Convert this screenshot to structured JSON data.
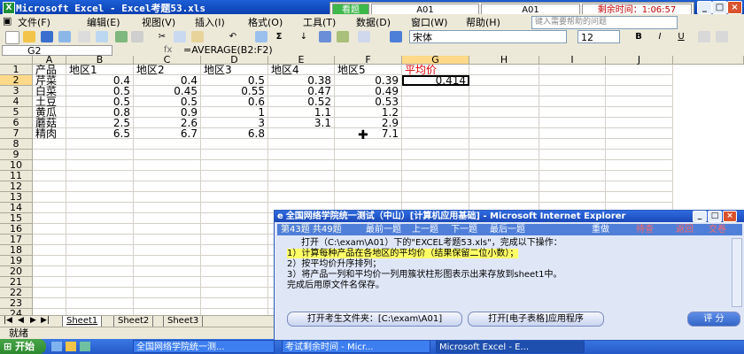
{
  "window": {
    "title": "Microsoft Excel - Excel考题53.xls",
    "controls": [
      "_",
      "□",
      "×"
    ]
  },
  "exam_bar": {
    "mode": "看题",
    "field1": "A01",
    "field2": "A01",
    "timer_label": "剩余时间：1:06:57"
  },
  "menu": {
    "items": [
      "文件(F)",
      "编辑(E)",
      "视图(V)",
      "插入(I)",
      "格式(O)",
      "工具(T)",
      "数据(D)",
      "窗口(W)",
      "帮助(H)"
    ],
    "help_placeholder": "键入需要帮助的问题"
  },
  "toolbar": {
    "font_name": "宋体",
    "font_size": "12",
    "bold": "B",
    "italic": "I",
    "underline": "U",
    "sigma": "Σ",
    "undo": "↶",
    "sort": "↓"
  },
  "formula_bar": {
    "name_box": "G2",
    "formula": "=AVERAGE(B2:F2)"
  },
  "grid": {
    "columns": [
      "A",
      "B",
      "C",
      "D",
      "E",
      "F",
      "G",
      "H",
      "I",
      "J"
    ],
    "rows": [
      "1",
      "2",
      "3",
      "4",
      "5",
      "6",
      "7",
      "8",
      "9",
      "10",
      "11",
      "12",
      "13",
      "14",
      "15",
      "16",
      "17",
      "18",
      "19",
      "20",
      "21",
      "22",
      "23",
      "24"
    ],
    "header_row": [
      "产品",
      "地区1",
      "地区2",
      "地区3",
      "地区4",
      "地区5",
      "平均价"
    ],
    "data": [
      [
        "芹菜",
        "0.4",
        "0.4",
        "0.5",
        "0.38",
        "0.39",
        "0.414"
      ],
      [
        "白菜",
        "0.5",
        "0.45",
        "0.55",
        "0.47",
        "0.49",
        ""
      ],
      [
        "土豆",
        "0.5",
        "0.5",
        "0.6",
        "0.52",
        "0.53",
        ""
      ],
      [
        "黄瓜",
        "0.8",
        "0.9",
        "1",
        "1.1",
        "1.2",
        ""
      ],
      [
        "蘑菇",
        "2.5",
        "2.6",
        "3",
        "3.1",
        "2.9",
        ""
      ],
      [
        "精肉",
        "6.5",
        "6.7",
        "6.8",
        "",
        "7.1",
        ""
      ]
    ]
  },
  "sheets": [
    "Sheet1",
    "Sheet2",
    "Sheet3"
  ],
  "status": "就绪",
  "taskbar": {
    "start": "开始",
    "tasks": [
      "全国网络学院统一测...",
      "考试剩余时间 - Micr...",
      "Microsoft Excel - E..."
    ]
  },
  "dialog": {
    "title": "全国网络学院统一测试（中山）[计算机应用基础] - Microsoft Internet Explorer",
    "question_no": "第43题 共49题",
    "nav": [
      "最前一题",
      "上一题",
      "下一题",
      "最后一题"
    ],
    "actions": [
      "重做",
      "待查",
      "返回",
      "交卷"
    ],
    "lines": [
      "打开（C:\\exam\\A01）下的\"EXCEL考题53.xls\"，完成以下操作：",
      "1）计算每种产品在各地区的平均价（结果保留二位小数）；",
      "2）按平均价升序排列；",
      "3）将产品一列和平均价一列用簇状柱形图表示出来存放到sheet1中。",
      "完成后用原文件名保存。"
    ],
    "buttons": [
      "打开考生文件夹：[C:\\exam\\A01]",
      "打开[电子表格]应用程序",
      "评 分"
    ]
  },
  "colors": {
    "title_blue": "#0a3fb0",
    "header_red": "#e00000",
    "highlight_yellow": "#ffff66",
    "selected_header": "#ffd98a"
  }
}
